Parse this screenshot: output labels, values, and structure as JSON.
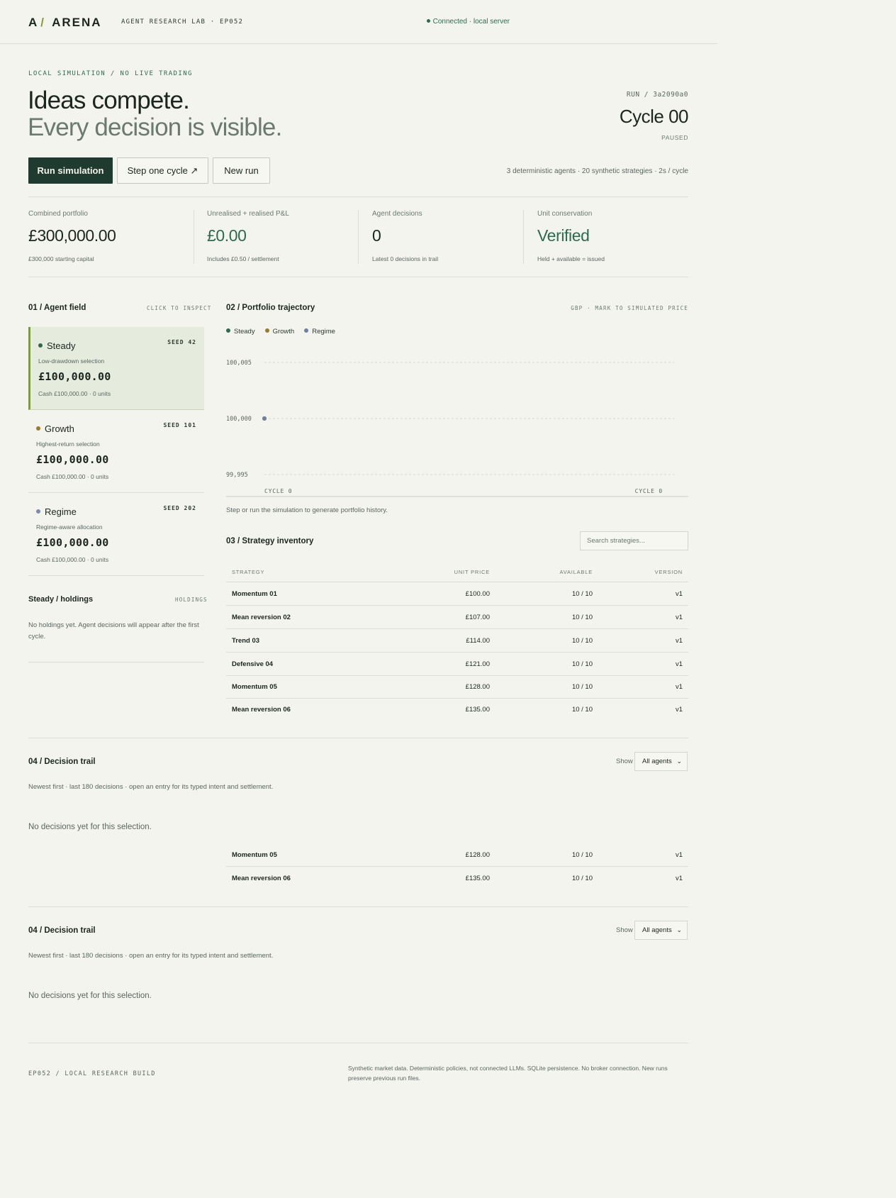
{
  "header": {
    "logo_a": "A",
    "logo_slash": "/",
    "logo_text": "ARENA",
    "lab": "AGENT RESEARCH LAB · EP052",
    "connection": "Connected · local server"
  },
  "hero": {
    "kicker": "LOCAL SIMULATION / NO LIVE TRADING",
    "title": "Ideas compete.",
    "title2": "Every decision is visible.",
    "run_id": "RUN / 3a2090a0",
    "cycle": "Cycle 00",
    "status": "PAUSED",
    "buttons": {
      "run": "Run simulation",
      "step": "Step one cycle ↗",
      "new": "New run"
    },
    "meta": "3 deterministic agents · 20 synthetic strategies · 2s / cycle"
  },
  "metrics": [
    {
      "label": "Combined portfolio",
      "value": "£300,000.00",
      "sub": "£300,000 starting capital"
    },
    {
      "label": "Unrealised + realised P&L",
      "value": "£0.00",
      "sub": "Includes £0.50 / settlement"
    },
    {
      "label": "Agent decisions",
      "value": "0",
      "sub": "Latest 0 decisions in trail"
    },
    {
      "label": "Unit conservation",
      "value": "Verified",
      "sub": "Held + available = issued"
    }
  ],
  "agent_field": {
    "title": "01 / Agent field",
    "tag": "CLICK TO INSPECT",
    "agents": [
      {
        "name": "Steady",
        "seed": "SEED 42",
        "desc": "Low-drawdown selection",
        "amount": "£100,000.00",
        "cash": "Cash £100,000.00 · 0 units",
        "color": "#2e6a50"
      },
      {
        "name": "Growth",
        "seed": "SEED 101",
        "desc": "Highest-return selection",
        "amount": "£100,000.00",
        "cash": "Cash £100,000.00 · 0 units",
        "color": "#9a7a30"
      },
      {
        "name": "Regime",
        "seed": "SEED 202",
        "desc": "Regime-aware allocation",
        "amount": "£100,000.00",
        "cash": "Cash £100,000.00 · 0 units",
        "color": "#7a8aa8"
      }
    ],
    "holdings_title": "Steady / holdings",
    "holdings_tag": "HOLDINGS",
    "holdings_msg": "No holdings yet. Agent decisions will appear after the first cycle."
  },
  "trajectory": {
    "title": "02 / Portfolio trajectory",
    "tag": "GBP · MARK TO SIMULATED PRICE",
    "note": "Step or run the simulation to generate portfolio history."
  },
  "chart_data": {
    "type": "line",
    "series": [
      {
        "name": "Steady",
        "color": "#2e6a50",
        "values": [
          100000
        ]
      },
      {
        "name": "Growth",
        "color": "#9a7a30",
        "values": [
          100000
        ]
      },
      {
        "name": "Regime",
        "color": "#6f80a3",
        "values": [
          100000
        ]
      }
    ],
    "x": [
      0
    ],
    "x_tick_labels": [
      "CYCLE 0",
      "CYCLE 0"
    ],
    "y_tick_labels": [
      "100,005",
      "100,000",
      "99,995"
    ],
    "ylim": [
      99995,
      100005
    ],
    "grid": true,
    "legend": "top-left"
  },
  "inventory": {
    "title": "03 / Strategy inventory",
    "search_placeholder": "Search strategies...",
    "columns": {
      "strategy": "STRATEGY",
      "price": "UNIT PRICE",
      "available": "AVAILABLE",
      "version": "VERSION"
    },
    "rows": [
      {
        "name": "Momentum 01",
        "price": "£100.00",
        "available": "10 / 10",
        "version": "v1"
      },
      {
        "name": "Mean reversion 02",
        "price": "£107.00",
        "available": "10 / 10",
        "version": "v1"
      },
      {
        "name": "Trend 03",
        "price": "£114.00",
        "available": "10 / 10",
        "version": "v1"
      },
      {
        "name": "Defensive 04",
        "price": "£121.00",
        "available": "10 / 10",
        "version": "v1"
      },
      {
        "name": "Momentum 05",
        "price": "£128.00",
        "available": "10 / 10",
        "version": "v1"
      },
      {
        "name": "Mean reversion 06",
        "price": "£135.00",
        "available": "10 / 10",
        "version": "v1"
      }
    ],
    "overflow_rows": [
      {
        "name": "Momentum 05",
        "price": "£128.00",
        "available": "10 / 10",
        "version": "v1"
      },
      {
        "name": "Mean reversion 06",
        "price": "£135.00",
        "available": "10 / 10",
        "version": "v1"
      }
    ]
  },
  "trail": {
    "title": "04 / Decision trail",
    "show": "Show",
    "filter": "All agents",
    "sub": "Newest first · last 180 decisions · open an entry for its typed intent and settlement.",
    "empty": "No decisions yet for this selection."
  },
  "footer": {
    "left": "EP052 / LOCAL RESEARCH BUILD",
    "right": "Synthetic market data. Deterministic policies, not connected LLMs. SQLite persistence. No broker connection. New runs preserve previous run files."
  }
}
